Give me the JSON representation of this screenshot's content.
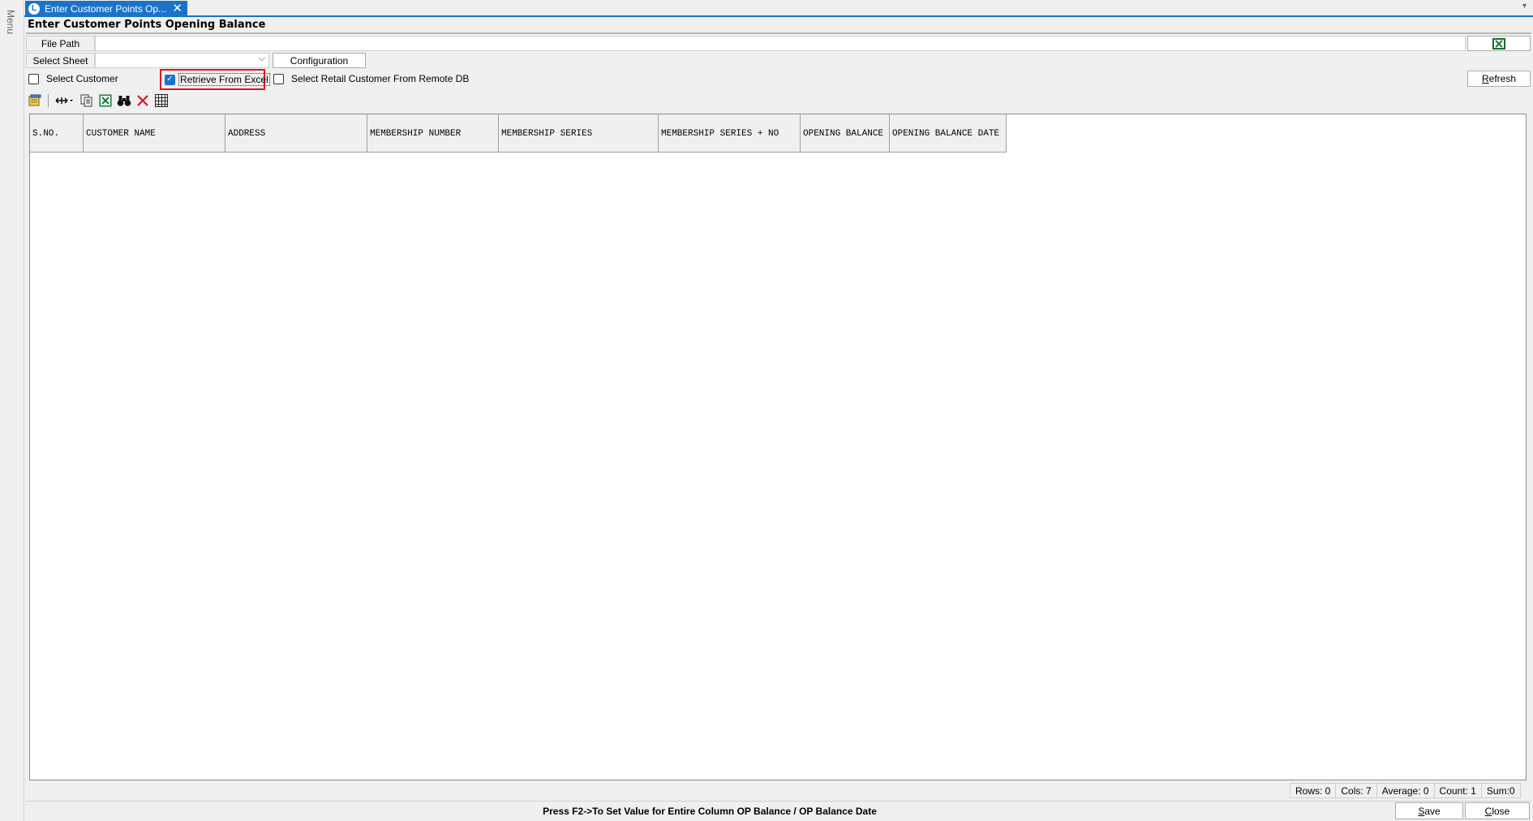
{
  "menu": {
    "label": "Menu"
  },
  "tab": {
    "title": "Enter Customer Points Op...",
    "logo": "L",
    "close_glyph": "✕"
  },
  "form": {
    "title": "Enter Customer Points Opening Balance"
  },
  "file_path": {
    "label": "File Path",
    "value": ""
  },
  "select_sheet": {
    "label": "Select Sheet",
    "value": "",
    "configuration_label": "Configuration"
  },
  "options": {
    "select_customer": {
      "label": "Select Customer",
      "checked": false
    },
    "retrieve_from_excel": {
      "label": "Retrieve From Excel",
      "checked": true
    },
    "select_retail_remote": {
      "label": "Select Retail Customer From Remote DB",
      "checked": false
    }
  },
  "refresh": {
    "label_first": "R",
    "label_rest": "efresh"
  },
  "toolbar": {
    "icons": [
      "layout-icon",
      "column-resize-icon",
      "copy-icon",
      "excel-export-icon",
      "find-icon",
      "delete-icon",
      "grid-icon"
    ]
  },
  "grid": {
    "columns": [
      "S.NO.",
      "CUSTOMER NAME",
      "ADDRESS",
      "MEMBERSHIP NUMBER",
      "MEMBERSHIP SERIES",
      "MEMBERSHIP SERIES + NO",
      "OPENING BALANCE",
      "OPENING BALANCE DATE"
    ],
    "rows": []
  },
  "status": {
    "rows": "Rows: 0",
    "cols": "Cols: 7",
    "average": "Average: 0",
    "count": "Count: 1",
    "sum": "Sum:0"
  },
  "footer": {
    "hint": "Press F2->To Set Value for Entire Column OP Balance / OP Balance Date",
    "save_first": "S",
    "save_rest": "ave",
    "close_first": "C",
    "close_rest": "lose"
  },
  "colors": {
    "accent": "#1a73c9",
    "highlight": "#e0161e",
    "excel_green": "#1d7a3a"
  }
}
